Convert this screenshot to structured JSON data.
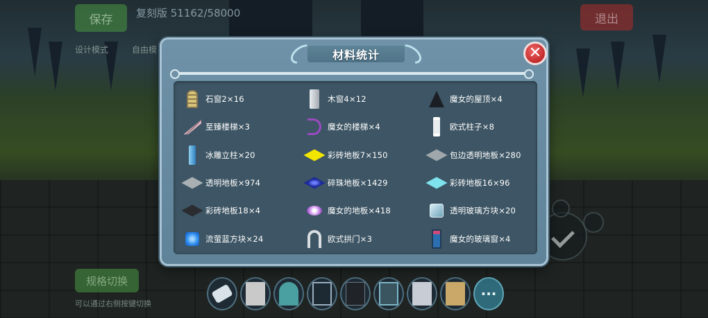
{
  "background": {
    "save_button": "保存",
    "title": "复刻版 51162/58000",
    "exit_button": "退出",
    "mode_tab": "设计模式",
    "mode_tab2": "自由模",
    "switch_button": "规格切换",
    "hint": "可以通过右侧按键切换"
  },
  "dialog": {
    "title": "材料统计",
    "close_icon": "close-icon",
    "items": [
      {
        "label": "石窗2×16",
        "icon": "stone-window-icon",
        "color": "#c9a94f"
      },
      {
        "label": "木窗4×12",
        "icon": "wood-window-icon",
        "color": "#c8ccd2"
      },
      {
        "label": "魔女的屋顶×4",
        "icon": "witch-roof-icon",
        "color": "#1b1f25"
      },
      {
        "label": "至臻楼梯×3",
        "icon": "stairs-icon",
        "color": "#e7b9c9"
      },
      {
        "label": "魔女的楼梯×4",
        "icon": "witch-stairs-icon",
        "color": "#9c4ac2"
      },
      {
        "label": "欧式柱子×8",
        "icon": "euro-pillar-icon",
        "color": "#e8ecef"
      },
      {
        "label": "冰雕立柱×20",
        "icon": "ice-pillar-icon",
        "color": "#4aa3d6"
      },
      {
        "label": "彩砖地板7×150",
        "icon": "yellow-tile-icon",
        "color": "#f2e600"
      },
      {
        "label": "包边透明地板×280",
        "icon": "edged-glass-floor-icon",
        "color": "#9fa7ab"
      },
      {
        "label": "透明地板×974",
        "icon": "glass-floor-icon",
        "color": "#a8b0b3"
      },
      {
        "label": "碎珠地板×1429",
        "icon": "bead-floor-icon",
        "color": "#1c2a9a"
      },
      {
        "label": "彩砖地板16×96",
        "icon": "cyan-tile-icon",
        "color": "#7fe3ee"
      },
      {
        "label": "彩砖地板18×4",
        "icon": "black-tile-icon",
        "color": "#2a2c30"
      },
      {
        "label": "魔女的地板×418",
        "icon": "witch-floor-icon",
        "color": "#d7a3f0"
      },
      {
        "label": "透明玻璃方块×20",
        "icon": "glass-cube-icon",
        "color": "#9ec7d8"
      },
      {
        "label": "流萤蓝方块×24",
        "icon": "firefly-blue-cube-icon",
        "color": "#2f8ff0"
      },
      {
        "label": "欧式拱门×3",
        "icon": "euro-arch-icon",
        "color": "#d9dee2"
      },
      {
        "label": "魔女的玻璃窗×4",
        "icon": "witch-glass-window-icon",
        "color": "#2c6fb0"
      }
    ]
  },
  "hotbar": {
    "more_label": "···",
    "slots": [
      "eraser-icon",
      "stone-block-icon",
      "tent-icon",
      "gate-icon",
      "dark-block-icon",
      "glass-panel-icon",
      "door-icon",
      "wood-block-icon"
    ]
  },
  "colors": {
    "dialog_bg": "#6f92a8",
    "panel_bg": "#3d5564",
    "close_red": "#d03a3a"
  }
}
